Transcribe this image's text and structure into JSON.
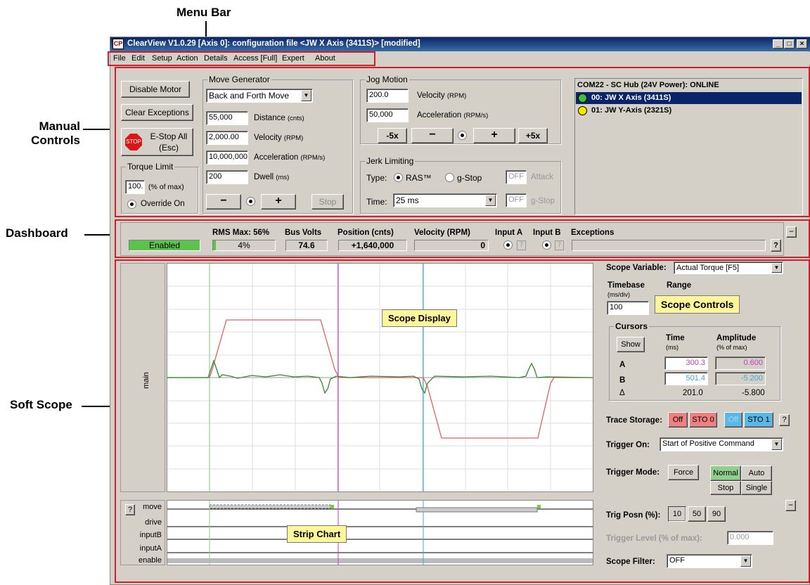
{
  "callouts": {
    "menu_bar": "Menu Bar",
    "manual_controls_1": "Manual",
    "manual_controls_2": "Controls",
    "dashboard": "Dashboard",
    "soft_scope": "Soft Scope"
  },
  "window": {
    "icon": "CP",
    "title": "ClearView V1.0.29 [Axis 0]: configuration file <JW X Axis (3411S)> [modified]",
    "min": "_",
    "max": "□",
    "close": "×"
  },
  "menu": [
    "File",
    "Edit",
    "Setup",
    "Action",
    "Details",
    "Access [Full]",
    "Expert",
    "About"
  ],
  "manual": {
    "disable_motor": "Disable Motor",
    "clear_exceptions": "Clear Exceptions",
    "stop_icon": "STOP",
    "estop_1": "E-Stop All",
    "estop_2": "(Esc)",
    "torque_title": "Torque Limit",
    "torque_value": "100.",
    "torque_unit": "(% of max)",
    "override": "Override On",
    "movegen_title": "Move Generator",
    "move_type": "Back and Forth Move",
    "distance": "55,000",
    "distance_lbl": "Distance",
    "distance_unit": "(cnts)",
    "velocity": "2,000.00",
    "velocity_lbl": "Velocity",
    "velocity_unit": "(RPM)",
    "accel": "10,000,000",
    "accel_lbl": "Acceleration",
    "accel_unit": "(RPM/s)",
    "dwell": "200",
    "dwell_lbl": "Dwell",
    "dwell_unit": "(ms)",
    "minus": "−",
    "plus": "+",
    "stop": "Stop",
    "jog_title": "Jog Motion",
    "jog_velocity": "200.0",
    "jog_velocity_lbl": "Velocity",
    "jog_velocity_unit": "(RPM)",
    "jog_accel": "50,000",
    "jog_accel_lbl": "Acceleration",
    "jog_accel_unit": "(RPM/s)",
    "m5x": "-5x",
    "p5x": "+5x",
    "jerk_title": "Jerk Limiting",
    "type_lbl": "Type:",
    "ras": "RAS™",
    "gstop": "g-Stop",
    "off1": "OFF",
    "attack": "Attack",
    "time_lbl": "Time:",
    "time_value": "25 ms",
    "off2": "OFF",
    "gstop2": "g-Stop"
  },
  "hub": {
    "header": "COM22 - SC Hub (24V Power):  ONLINE",
    "axes": [
      {
        "label": "00: JW X Axis (3411S)",
        "color": "#3cc13c",
        "selected": true
      },
      {
        "label": "01: JW Y-Axis (2321S)",
        "color": "#f2e600",
        "selected": false
      }
    ]
  },
  "dashboard": {
    "status": "Enabled",
    "rms_lbl": "RMS Max: 56%",
    "rms_val": "4%",
    "bus_lbl": "Bus Volts",
    "bus_val": "74.6",
    "pos_lbl": "Position (cnts)",
    "pos_val": "+1,640,000",
    "vel_lbl": "Velocity (RPM)",
    "vel_val": "0",
    "ina_lbl": "Input A",
    "inb_lbl": "Input B",
    "exc_lbl": "Exceptions",
    "q": "?",
    "collapse": "−"
  },
  "scope": {
    "ylabel": "main",
    "display_tag": "Scope Display",
    "strip_tag": "Strip Chart",
    "controls_tag": "Scope Controls",
    "var_lbl": "Scope Variable:",
    "var_val": "Actual Torque [F5]",
    "timebase_lbl": "Timebase",
    "timebase_unit": "(ms/div)",
    "timebase_val": "100",
    "range_lbl": "Range",
    "cursors_title": "Cursors",
    "show": "Show",
    "time_lbl": "Time",
    "time_unit": "(ms)",
    "amp_lbl": "Amplitude",
    "amp_unit": "(% of max)",
    "a_lbl": "A",
    "a_time": "300.3",
    "a_amp": "0.600",
    "b_lbl": "B",
    "b_time": "501.4",
    "b_amp": "-5.200",
    "d_lbl": "Δ",
    "d_time": "201.0",
    "d_amp": "-5.800",
    "trace_lbl": "Trace Storage:",
    "off": "Off",
    "sto0": "STO 0",
    "off2": "Off",
    "sto1": "STO 1",
    "q": "?",
    "trig_on_lbl": "Trigger On:",
    "trig_on_val": "Start of Positive Command",
    "trig_mode_lbl": "Trigger Mode:",
    "force": "Force",
    "normal": "Normal",
    "auto": "Auto",
    "stop": "Stop",
    "single": "Single",
    "posn_lbl": "Trig Posn (%):",
    "p10": "10",
    "p50": "50",
    "p90": "90",
    "level_lbl": "Trigger Level (% of max):",
    "level_val": "0.000",
    "filter_lbl": "Scope Filter:",
    "filter_val": "OFF",
    "collapse": "−",
    "strip_rows": [
      "move",
      "drive",
      "inputB",
      "inputA",
      "enable"
    ]
  },
  "colors": {
    "red_box": "#d21e28",
    "cursor_a": "#c040c0",
    "cursor_b": "#40a8d8",
    "trace_green": "#2e8b2e",
    "trace_red": "#e06060"
  }
}
